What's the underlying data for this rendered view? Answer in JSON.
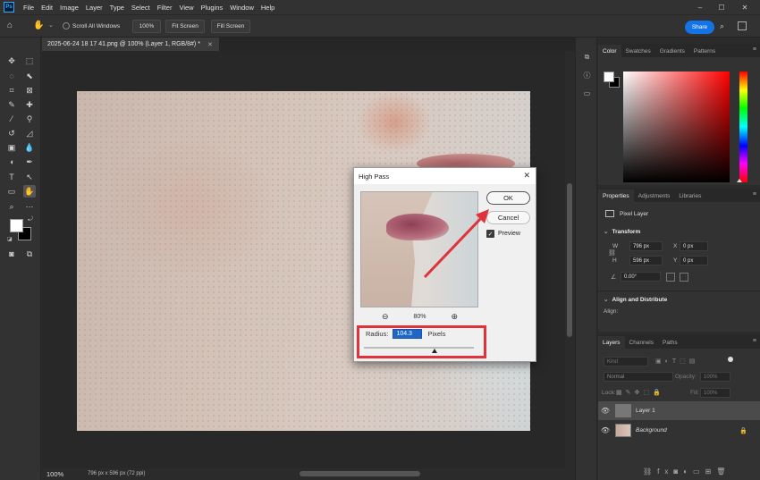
{
  "app": {
    "logo": "Ps",
    "menu": [
      "File",
      "Edit",
      "Image",
      "Layer",
      "Type",
      "Select",
      "Filter",
      "View",
      "Plugins",
      "Window",
      "Help"
    ],
    "window_controls": {
      "minimize": "–",
      "maximize": "☐",
      "close": "✕"
    }
  },
  "options_bar": {
    "scroll_all_windows": "Scroll All Windows",
    "zoom_100": "100%",
    "fit_screen": "Fit Screen",
    "fill_screen": "Fill Screen",
    "share": "Share"
  },
  "document": {
    "tab_title": "2025-06-24 18 17 41.png @ 100% (Layer 1, RGB/8#) *",
    "tab_close": "✕",
    "status_zoom": "100%",
    "status_dimensions": "796 px x 596 px (72 ppi)"
  },
  "color_panel": {
    "tabs": [
      "Color",
      "Swatches",
      "Gradients",
      "Patterns"
    ],
    "foreground": "#ffffff",
    "background": "#000000"
  },
  "properties_panel": {
    "tabs": [
      "Properties",
      "Adjustments",
      "Libraries"
    ],
    "layer_type": "Pixel Layer",
    "transform_title": "Transform",
    "w_label": "W",
    "w_value": "796 px",
    "h_label": "H",
    "h_value": "596 px",
    "x_label": "X",
    "x_value": "0 px",
    "y_label": "Y",
    "y_value": "0 px",
    "angle_value": "0.00°",
    "align_title": "Align and Distribute",
    "align_label": "Align:"
  },
  "layers_panel": {
    "tabs": [
      "Layers",
      "Channels",
      "Paths"
    ],
    "kind_placeholder": "Kind",
    "blend_mode": "Normal",
    "opacity_label": "Opacity:",
    "opacity_value": "100%",
    "lock_label": "Lock:",
    "fill_label": "Fill:",
    "fill_value": "100%",
    "layers": [
      {
        "name": "Layer 1",
        "selected": true
      },
      {
        "name": "Background",
        "selected": false,
        "locked": true
      }
    ]
  },
  "high_pass_dialog": {
    "title": "High Pass",
    "ok": "OK",
    "cancel": "Cancel",
    "preview_label": "Preview",
    "preview_checked": true,
    "zoom_level": "80%",
    "radius_label": "Radius:",
    "radius_value": "104.3",
    "radius_unit": "Pixels"
  },
  "annotation": {
    "highlight_color": "#e0323a",
    "arrow_color": "#e0323a"
  }
}
